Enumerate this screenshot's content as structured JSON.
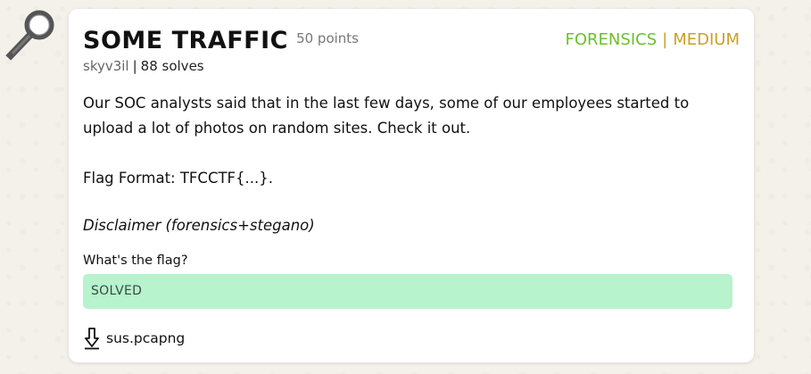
{
  "challenge": {
    "title": "SOME TRAFFIC",
    "points": "50 points",
    "category": "FORENSICS",
    "separator": "|",
    "difficulty": "MEDIUM",
    "author": "skyv3il",
    "meta_separator": "|",
    "solves": "88 solves",
    "description_line1": "Our SOC analysts said that in the last few days, some of our employees started to upload a lot of photos on random sites. Check it out.",
    "flag_format": "Flag Format: TFCCTF{...}.",
    "disclaimer": "Disclaimer (forensics+stegano)",
    "question": "What's the flag?",
    "status": "SOLVED",
    "attachment": "sus.pcapng"
  },
  "icons": {
    "magnifier": "magnifier-icon",
    "download": "download-icon"
  },
  "colors": {
    "category": "#6cc02b",
    "difficulty": "#c9a227",
    "solved_bg": "#b7f3cd",
    "background": "#f3f1ea"
  }
}
